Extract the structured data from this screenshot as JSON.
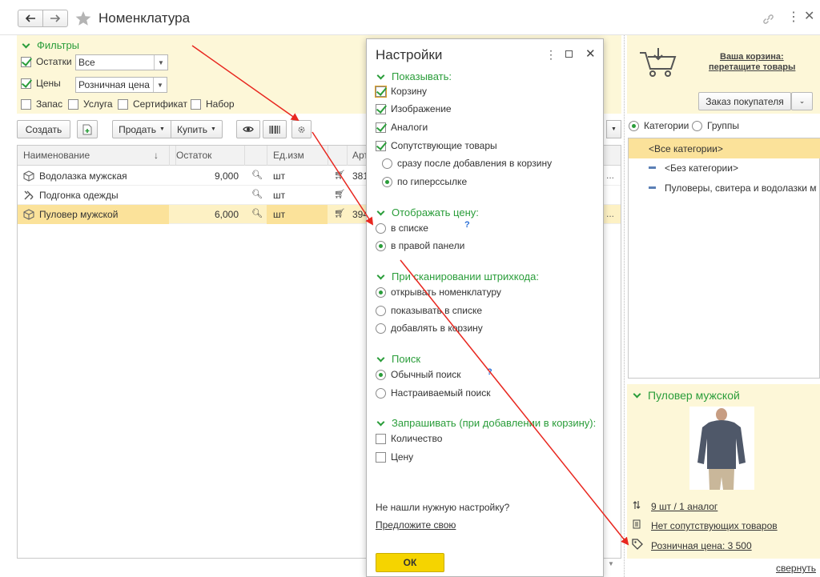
{
  "window": {
    "title": "Номенклатура",
    "back_icon": "arrow-left-icon",
    "forward_icon": "arrow-right-icon",
    "star_icon": "star-icon"
  },
  "filters": {
    "header": "Фильтры",
    "ostatki_label": "Остатки",
    "ostatki_value": "Все",
    "ceny_label": "Цены",
    "ceny_value": "Розничная цена",
    "zapas": "Запас",
    "usluga": "Услуга",
    "sertifikat": "Сертификат",
    "nabor": "Набор"
  },
  "toolbar": {
    "create": "Создать",
    "sell": "Продать",
    "buy": "Купить"
  },
  "table": {
    "columns": [
      "Наименование",
      "Остаток",
      "Ед.изм",
      "Арт"
    ],
    "rows": [
      {
        "name": "Водолазка мужская",
        "qty": "9,000",
        "unit": "шт",
        "art": "381"
      },
      {
        "name": "Подгонка одежды",
        "qty": "",
        "unit": "шт",
        "art": ""
      },
      {
        "name": "Пуловер мужской",
        "qty": "6,000",
        "unit": "шт",
        "art": "394"
      }
    ]
  },
  "dialog": {
    "title": "Настройки",
    "show_header": "Показывать:",
    "show_items": [
      "Корзину",
      "Изображение",
      "Аналоги",
      "Сопутствующие товары"
    ],
    "related_options": [
      "сразу после добавления в корзину",
      "по гиперссылке"
    ],
    "price_header": "Отображать цену:",
    "price_options": [
      "в списке",
      "в правой панели"
    ],
    "help_mark": "?",
    "scan_header": "При сканировании штрихкода:",
    "scan_options": [
      "открывать номенклатуру",
      "показывать в списке",
      "добавлять в корзину"
    ],
    "search_header": "Поиск",
    "search_options": [
      "Обычный поиск",
      "Настраиваемый поиск"
    ],
    "ask_header": "Запрашивать (при добавлении в корзину):",
    "ask_options": [
      "Количество",
      "Цену"
    ],
    "not_found": "Не нашли нужную настройку?",
    "suggest": "Предложите свою",
    "ok": "ОК"
  },
  "cart": {
    "title": "Ваша корзина:",
    "subtitle": "перетащите товары",
    "order_button": "Заказ покупателя"
  },
  "categories": {
    "mode_categories": "Категории",
    "mode_groups": "Группы",
    "items": [
      "<Все категории>",
      "<Без категории>",
      "Пуловеры, свитера и водолазки муж"
    ]
  },
  "product": {
    "title": "Пуловер мужской",
    "analogs": "9 шт / 1 аналог",
    "related": "Нет сопутствующих товаров",
    "price": "Розничная цена: 3 500",
    "collapse": "свернуть"
  },
  "colors": {
    "accent_green": "#2a9d3a",
    "panel_yellow": "#fdf7d8",
    "selected_row": "#fbe29a",
    "ok_button": "#f5d400",
    "arrow_red": "#e8271f"
  }
}
